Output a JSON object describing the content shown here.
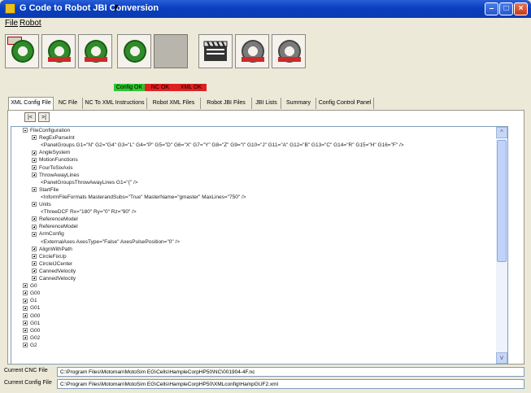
{
  "window": {
    "title": "G Code to Robot JBI Conversion"
  },
  "menu": {
    "items": [
      "File",
      "Robot"
    ]
  },
  "toolbar": {
    "buttons": [
      {
        "name": "gear-green-1"
      },
      {
        "name": "gear-green-2"
      },
      {
        "name": "gear-green-3"
      },
      {
        "name": "empty-slot"
      },
      {
        "name": "clapper"
      },
      {
        "name": "gear-gray-1"
      },
      {
        "name": "gear-gray-2"
      }
    ]
  },
  "status_indicators": [
    {
      "label": "Config OK",
      "color": "#2fc42f"
    },
    {
      "label": "NC OK",
      "color": "#e02020"
    },
    {
      "label": "XML OK",
      "color": "#e02020"
    }
  ],
  "tabs": [
    {
      "label": "XML Config File",
      "active": true
    },
    {
      "label": "NC File",
      "active": false
    },
    {
      "label": "NC To XML Instructions",
      "active": false
    },
    {
      "label": "Robot XML Files",
      "active": false
    },
    {
      "label": "Robot JBI Files",
      "active": false
    },
    {
      "label": "JBI Lists",
      "active": false
    },
    {
      "label": "Summary",
      "active": false
    },
    {
      "label": "Config Control Panel",
      "active": false
    }
  ],
  "nav": {
    "prev": "|<",
    "next": ">|"
  },
  "tree": [
    {
      "text": "FileConfiguration",
      "expander": "minus"
    },
    {
      "text": "RegExParseInt",
      "expander": "plus"
    },
    {
      "text": "<PanelGroups G1=\"N\" G2=\"G4\" G3=\"L\" G4=\"P\" G5=\"D\" G6=\"X\" G7=\"Y\" G8=\"Z\" G9=\"I\" G10=\"J\" G11=\"A\" G12=\"B\" G13=\"C\" G14=\"R\" G15=\"H\" G16=\"F\" />",
      "expander": "none"
    },
    {
      "text": "AngleSystem",
      "expander": "plus"
    },
    {
      "text": "MotionFunctions",
      "expander": "plus"
    },
    {
      "text": "FourToSixAxis",
      "expander": "plus"
    },
    {
      "text": "ThrowAwayLines",
      "expander": "plus"
    },
    {
      "text": "<PanelGroupsThrowAwayLines G1=\"(\" />",
      "expander": "none"
    },
    {
      "text": "StartFile",
      "expander": "plus"
    },
    {
      "text": "<InformFileFormats MasterandSubs=\"True\" MasterName=\"gmaster\" MaxLines=\"750\" />",
      "expander": "none"
    },
    {
      "text": "Units",
      "expander": "plus"
    },
    {
      "text": "<ThreeDCF Rx=\"180\" Ry=\"0\" Rz=\"90\" />",
      "expander": "none"
    },
    {
      "text": "ReferenceModel",
      "expander": "plus"
    },
    {
      "text": "ReferenceModel",
      "expander": "plus"
    },
    {
      "text": "ArmConfig",
      "expander": "plus"
    },
    {
      "text": "<ExternalAxes AxesType=\"False\" AxesPulsePosition=\"0\" />",
      "expander": "none"
    },
    {
      "text": "AlignWithPath",
      "expander": "plus"
    },
    {
      "text": "CircleFixUp",
      "expander": "plus"
    },
    {
      "text": "CircleIJCenter",
      "expander": "plus"
    },
    {
      "text": "CannedVelocity",
      "expander": "plus"
    },
    {
      "text": "CannedVelocity",
      "expander": "plus"
    },
    {
      "text": "G0",
      "expander": "plus"
    },
    {
      "text": "G00",
      "expander": "plus"
    },
    {
      "text": "G1",
      "expander": "plus"
    },
    {
      "text": "G01",
      "expander": "plus"
    },
    {
      "text": "G00",
      "expander": "plus"
    },
    {
      "text": "G01",
      "expander": "plus"
    },
    {
      "text": "G00",
      "expander": "plus"
    },
    {
      "text": "G02",
      "expander": "plus"
    },
    {
      "text": "G2",
      "expander": "plus"
    }
  ],
  "footer": {
    "cnc_label": "Current CNC File",
    "cnc_value": "C:\\Program Files\\Motoman\\MotoSim EG\\Cells\\HampleCorpHP50\\NC\\001904-4F.nc",
    "config_label": "Current Config File",
    "config_value": "C:\\Program Files\\Motoman\\MotoSim EG\\Cells\\HampleCorpHP50\\XMLconfig\\HampGUF2.xml"
  },
  "colors": {
    "title_blue": "#0a3fbf",
    "ok_green": "#2fc42f",
    "bad_red": "#e02020"
  }
}
